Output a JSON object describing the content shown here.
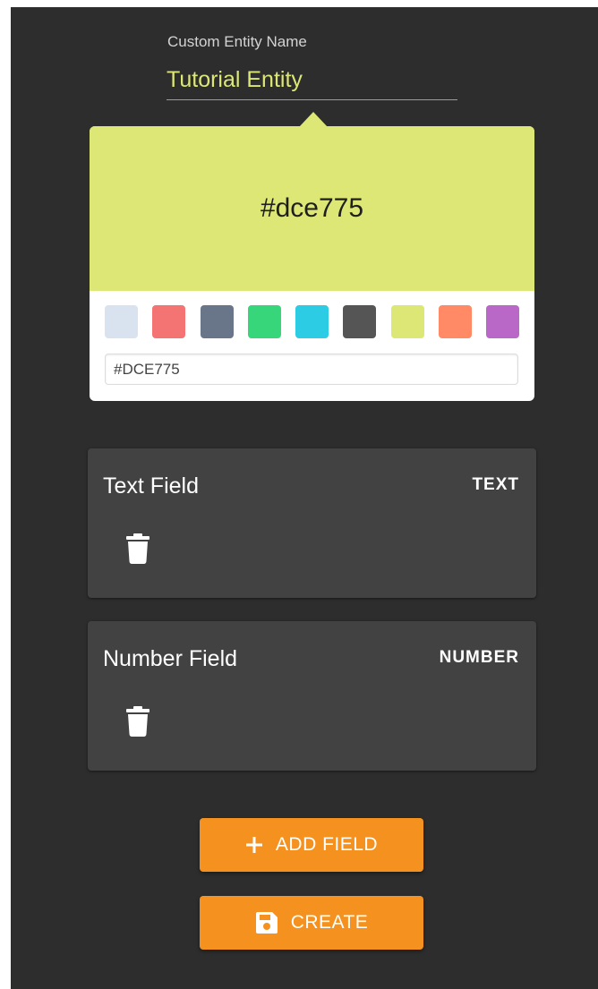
{
  "entity_name": {
    "label": "Custom Entity Name",
    "value": "Tutorial Entity"
  },
  "color_picker": {
    "selected_display": "#dce775",
    "hex_value": "#DCE775",
    "selected_color": "#dce775",
    "swatches": [
      "#d9e3f0",
      "#f47373",
      "#697689",
      "#37d67a",
      "#2ccce4",
      "#555555",
      "#dce775",
      "#ff8a65",
      "#ba68c8"
    ]
  },
  "fields": [
    {
      "name": "Text Field",
      "type": "TEXT",
      "delete_icon": "trash-icon"
    },
    {
      "name": "Number Field",
      "type": "NUMBER",
      "delete_icon": "trash-icon"
    }
  ],
  "buttons": {
    "add_field": {
      "label": "ADD FIELD",
      "icon": "plus-icon"
    },
    "create": {
      "label": "CREATE",
      "icon": "save-icon"
    }
  },
  "colors": {
    "background": "#2d2d2d",
    "card": "#424242",
    "accent": "#f5921f"
  }
}
